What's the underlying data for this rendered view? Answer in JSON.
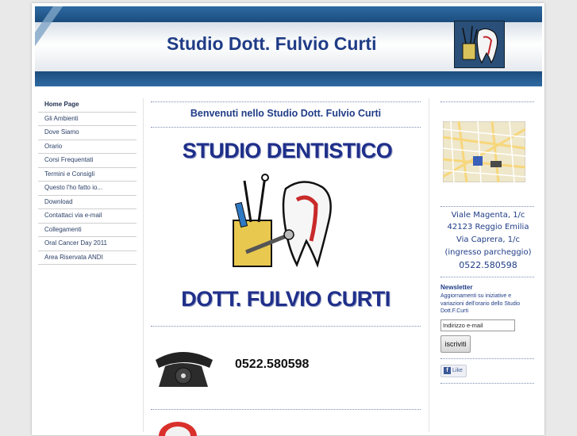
{
  "header": {
    "title": "Studio Dott. Fulvio Curti",
    "logo_icon": "dental-tools-logo-icon"
  },
  "nav": {
    "items": [
      {
        "label": "Home Page",
        "active": true
      },
      {
        "label": "Gli Ambienti"
      },
      {
        "label": "Dove Siamo"
      },
      {
        "label": "Orario"
      },
      {
        "label": "Corsi Frequentati"
      },
      {
        "label": "Termini e Consigli"
      },
      {
        "label": "Questo l'ho fatto io..."
      },
      {
        "label": "Download"
      },
      {
        "label": "Contattaci via e-mail"
      },
      {
        "label": "Collegamenti"
      },
      {
        "label": "Oral Cancer Day 2011"
      },
      {
        "label": "Area Riservata ANDI"
      }
    ]
  },
  "main": {
    "welcome": "Benvenuti nello Studio Dott. Fulvio Curti",
    "banner_top": "STUDIO DENTISTICO",
    "banner_bottom": "DOTT. FULVIO CURTI",
    "phone": "0522.580598"
  },
  "sidebar": {
    "address": [
      "Viale Magenta, 1/c",
      "42123 Reggio Emilia",
      "Via  Caprera, 1/c",
      "(ingresso parcheggio)",
      "0522.580598"
    ],
    "newsletter_title": "Newsletter",
    "newsletter_text": "Aggiornamenti su iniziative e variazioni dell'orario dello Studio Dott.F.Curti",
    "email_placeholder": "Indirizzo e-mail",
    "subscribe_label": "iscriviti",
    "like_label": "Like"
  },
  "colors": {
    "accent": "#1f3c86",
    "header_blue": "#1e4f7e"
  }
}
